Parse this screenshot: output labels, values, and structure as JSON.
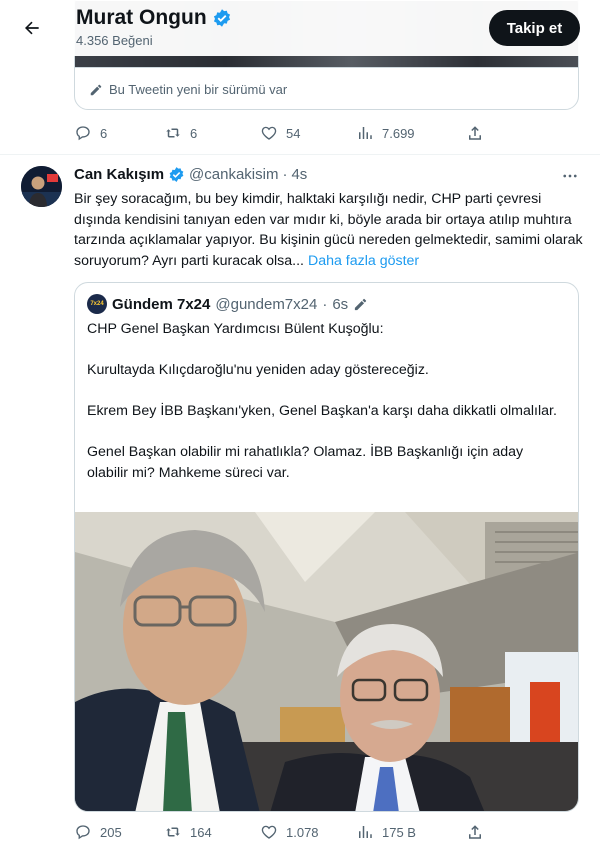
{
  "header": {
    "name": "Murat Ongun",
    "likes_count": "4.356 Beğeni",
    "follow_label": "Takip et",
    "back_icon": "arrow-left-icon",
    "verified_icon": "verified-badge-icon"
  },
  "previous_tweet": {
    "edited_notice": "Bu Tweetin yeni bir sürümü var",
    "stats": {
      "replies": "6",
      "retweets": "6",
      "likes": "54",
      "views": "7.699"
    }
  },
  "tweet": {
    "author_name": "Can Kakışım",
    "handle": "@cankakisim",
    "separator": "·",
    "time": "4s",
    "text": "Bir şey soracağım, bu bey kimdir, halktaki karşılığı nedir, CHP parti çevresi dışında kendisini tanıyan eden var mıdır ki, böyle arada bir ortaya atılıp muhtıra tarzında açıklamalar yapıyor. Bu kişinin gücü nereden gelmektedir, samimi olarak soruyorum? Ayrı parti kuracak olsa...",
    "show_more": "Daha fazla göster",
    "stats": {
      "replies": "205",
      "retweets": "164",
      "likes": "1.078",
      "views": "175 B"
    }
  },
  "quoted_tweet": {
    "author_name": "Gündem 7x24",
    "avatar_text": "7x24",
    "handle": "@gundem7x24",
    "separator": "·",
    "time": "6s",
    "paragraphs": [
      "CHP Genel Başkan Yardımcısı Bülent Kuşoğlu:",
      "Kurultayda Kılıçdaroğlu'nu yeniden aday göstereceğiz.",
      "Ekrem Bey İBB Başkanı'yken, Genel Başkan'a karşı daha dikkatli olmalılar.",
      "Genel Başkan olabilir mi rahatlıkla? Olamaz. İBB Başkanlığı için aday olabilir mi? Mahkeme süreci var."
    ]
  },
  "colors": {
    "accent": "#1d9bf0",
    "text": "#0f1419",
    "muted": "#536471",
    "border": "#cfd9de"
  }
}
